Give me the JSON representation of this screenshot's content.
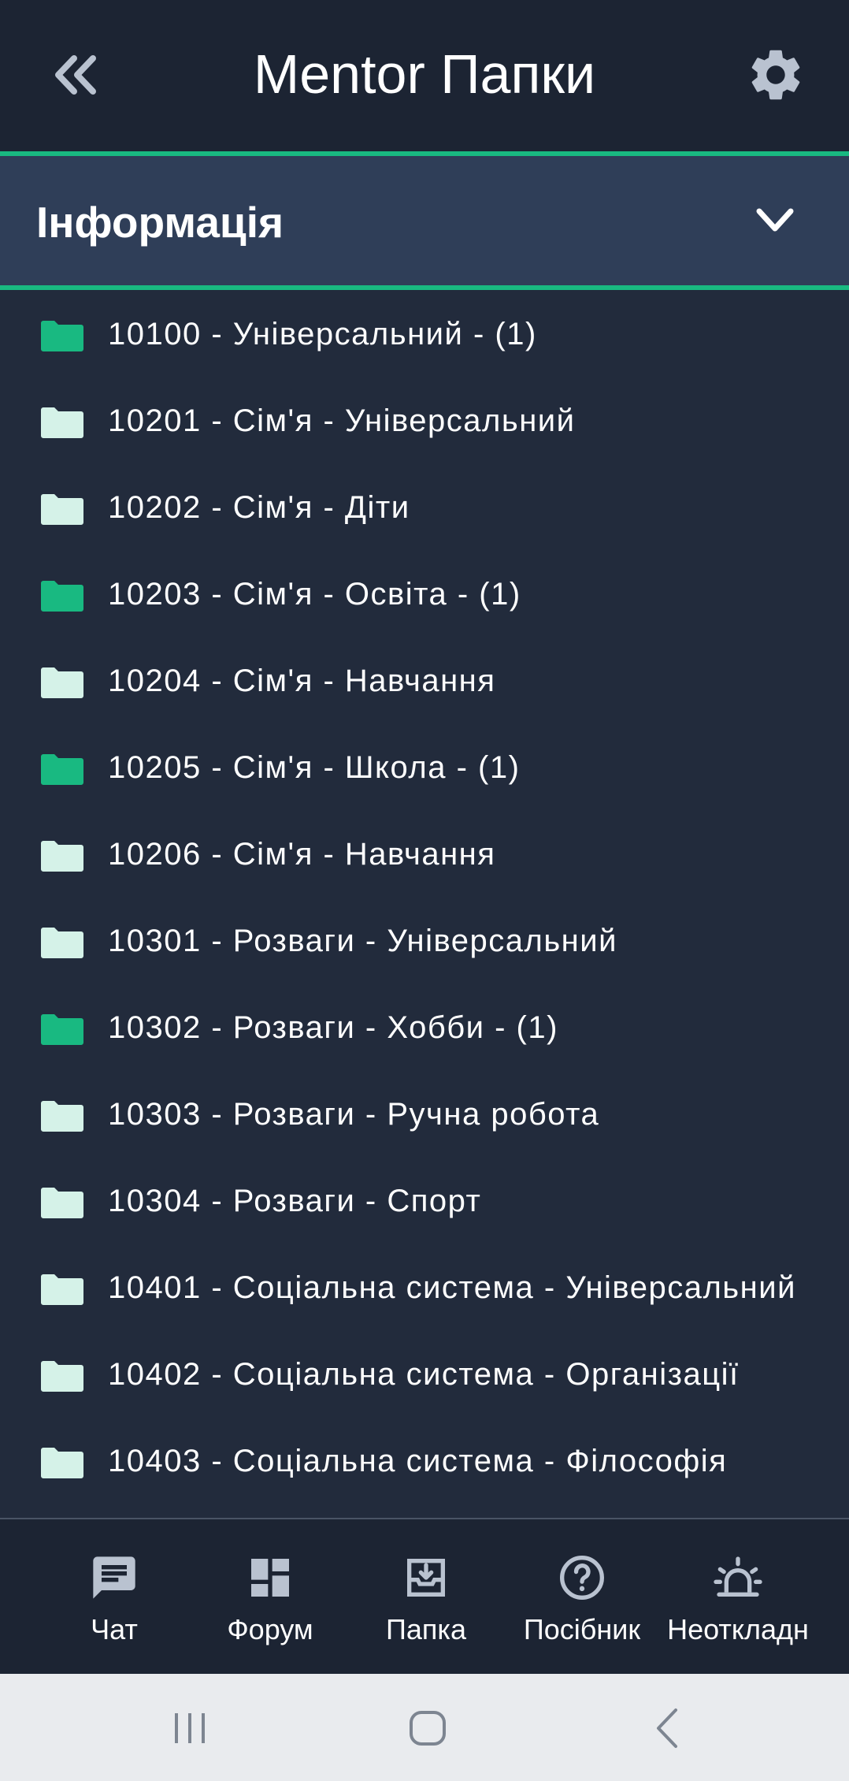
{
  "header": {
    "title": "Mentor Папки",
    "back_icon": "double-chevron-left-icon",
    "settings_icon": "gear-icon"
  },
  "section": {
    "label": "Інформація",
    "toggle_icon": "chevron-down-icon"
  },
  "colors": {
    "background": "#222b3c",
    "topbar": "#1c2433",
    "section": "#2f3e58",
    "accent": "#19b981",
    "folder_filled": "#19b981",
    "folder_empty": "#d5f2e8"
  },
  "folders": [
    {
      "label": "10100 - Універсальний - (1)",
      "has_items": true
    },
    {
      "label": "10201 - Сім'я - Універсальний",
      "has_items": false
    },
    {
      "label": "10202 - Сім'я - Діти",
      "has_items": false
    },
    {
      "label": "10203 - Сім'я - Освіта - (1)",
      "has_items": true
    },
    {
      "label": "10204 - Сім'я - Навчання",
      "has_items": false
    },
    {
      "label": "10205 - Сім'я - Школа - (1)",
      "has_items": true
    },
    {
      "label": "10206 - Сім'я - Навчання",
      "has_items": false
    },
    {
      "label": "10301 - Розваги - Універсальний",
      "has_items": false
    },
    {
      "label": "10302 - Розваги - Хобби - (1)",
      "has_items": true
    },
    {
      "label": "10303 - Розваги - Ручна робота",
      "has_items": false
    },
    {
      "label": "10304 - Розваги - Спорт",
      "has_items": false
    },
    {
      "label": "10401 - Соціальна система - Універсальний",
      "has_items": false
    },
    {
      "label": "10402 - Соціальна система - Організації",
      "has_items": false
    },
    {
      "label": "10403 - Соціальна система - Філософія",
      "has_items": false
    }
  ],
  "bottom_nav": [
    {
      "label": "Чат",
      "icon": "chat-icon"
    },
    {
      "label": "Форум",
      "icon": "dashboard-icon"
    },
    {
      "label": "Папка",
      "icon": "archive-icon"
    },
    {
      "label": "Посібник",
      "icon": "help-icon"
    },
    {
      "label": "Неоткладн",
      "icon": "alarm-light-icon"
    }
  ],
  "system_nav": {
    "recents_icon": "recents-icon",
    "home_icon": "home-icon",
    "back_icon": "back-icon"
  }
}
